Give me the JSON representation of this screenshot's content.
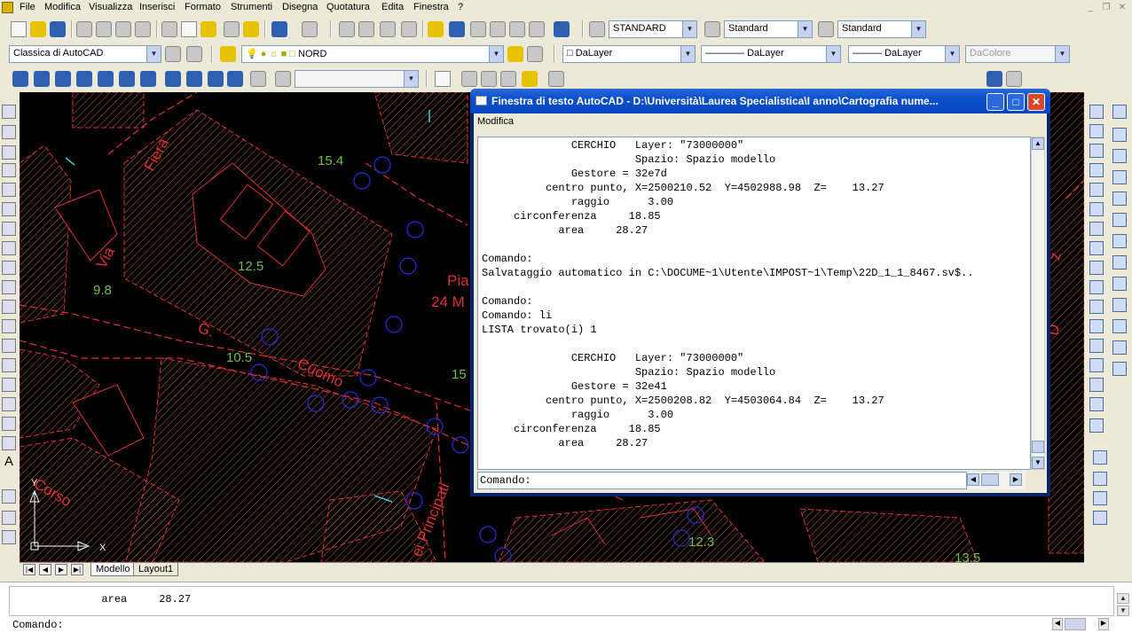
{
  "menubar": {
    "items": [
      "File",
      "Modifica",
      "Visualizza",
      "Inserisci",
      "Formato",
      "Strumenti",
      "Disegna",
      "Quotatura",
      "Edita",
      "Finestra",
      "?"
    ]
  },
  "toolbar1": {
    "text_style": "STANDARD",
    "dim_style": "Standard",
    "table_style": "Standard"
  },
  "toolbar2": {
    "workspace": "Classica di AutoCAD",
    "layer": "NORD",
    "color": "DaLayer",
    "linetype": "DaLayer",
    "lineweight": "DaLayer",
    "plotstyle": "DaColore"
  },
  "map_labels": {
    "fiera": "Fiera",
    "via": "Via",
    "corso": "Corso",
    "cuomo": "Cuomo",
    "g": "G.",
    "principati": "ei Principati",
    "pia": "Pia",
    "m24": "24 M",
    "d": "D",
    "z": "z",
    "h154": "15.4",
    "h125": "12.5",
    "h98": "9.8",
    "h105": "10.5",
    "h15": "15",
    "h123": "12.3",
    "h135": "13.5",
    "ucs_x": "X",
    "ucs_y": "Y"
  },
  "layout_tabs": [
    "Modello",
    "Layout1"
  ],
  "text_window": {
    "title": "Finestra di testo AutoCAD - D:\\Università\\Laurea Specialistica\\I anno\\Cartografia nume...",
    "menu": "Modifica",
    "lines": [
      "              CERCHIO   Layer: \"73000000\"",
      "                        Spazio: Spazio modello",
      "              Gestore = 32e7d",
      "          centro punto, X=2500210.52  Y=4502988.98  Z=    13.27",
      "              raggio      3.00",
      "     circonferenza     18.85",
      "            area     28.27",
      "",
      "Comando:",
      "Salvataggio automatico in C:\\DOCUME~1\\Utente\\IMPOST~1\\Temp\\22D_1_1_8467.sv$..",
      "",
      "Comando:",
      "Comando: li",
      "LISTA trovato(i) 1",
      "",
      "              CERCHIO   Layer: \"73000000\"",
      "                        Spazio: Spazio modello",
      "              Gestore = 32e41",
      "          centro punto, X=2500208.82  Y=4503064.84  Z=    13.27",
      "              raggio      3.00",
      "     circonferenza     18.85",
      "            area     28.27"
    ],
    "command_prompt": "Comando:"
  },
  "command_area": {
    "history_line": "            area     28.27",
    "prompt": "Comando:"
  },
  "colors": {
    "drawing_bg": "#000000",
    "boundary_red": "#e02020",
    "hatch_orange": "#c86a3a",
    "label_green": "#6fbf4f",
    "circle_blue": "#2a2ae0",
    "titlebar_blue": "#0a4fcc"
  }
}
